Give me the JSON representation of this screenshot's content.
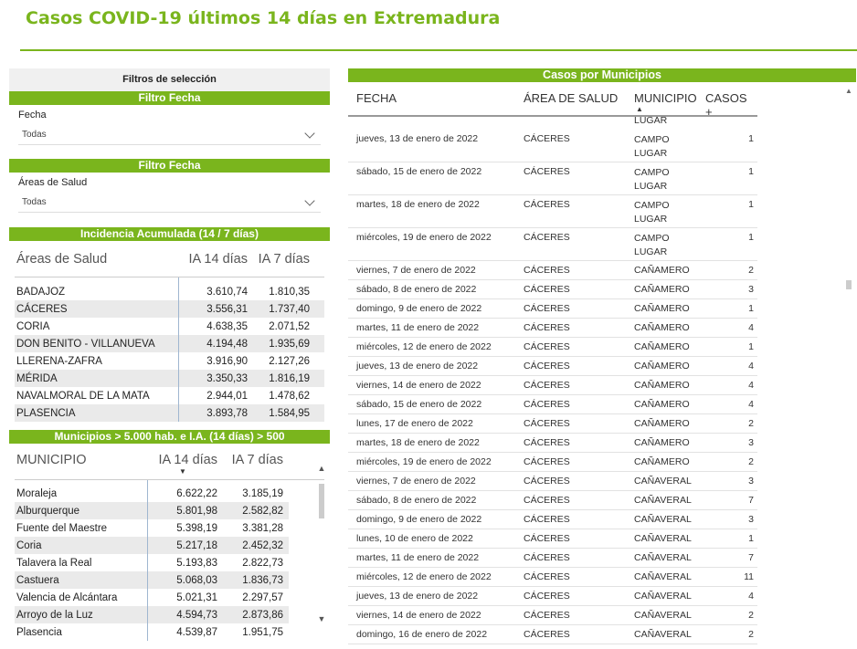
{
  "title": "Casos COVID-19 últimos 14 días en Extremadura",
  "filters": {
    "header": "Filtros de selección",
    "date_filter": {
      "bar": "Filtro Fecha",
      "label": "Fecha",
      "value": "Todas"
    },
    "area_filter": {
      "bar": "Filtro Fecha",
      "label": "Áreas de Salud",
      "value": "Todas"
    }
  },
  "incidence": {
    "bar": "Incidencia Acumulada (14 / 7 días)",
    "headers": [
      "Áreas de Salud",
      "IA 14 días",
      "IA 7 días"
    ],
    "rows": [
      [
        "BADAJOZ",
        "3.610,74",
        "1.810,35"
      ],
      [
        "CÁCERES",
        "3.556,31",
        "1.737,40"
      ],
      [
        "CORIA",
        "4.638,35",
        "2.071,52"
      ],
      [
        "DON BENITO - VILLANUEVA",
        "4.194,48",
        "1.935,69"
      ],
      [
        "LLERENA-ZAFRA",
        "3.916,90",
        "2.127,26"
      ],
      [
        "MÉRIDA",
        "3.350,33",
        "1.816,19"
      ],
      [
        "NAVALMORAL DE LA MATA",
        "2.944,01",
        "1.478,62"
      ],
      [
        "PLASENCIA",
        "3.893,78",
        "1.584,95"
      ]
    ]
  },
  "municipios": {
    "bar": "Municipios > 5.000 hab. e I.A. (14 días) > 500",
    "headers": [
      "MUNICIPIO",
      "IA 14 días",
      "IA 7 días"
    ],
    "sort_icon": "▼",
    "rows": [
      [
        "Moraleja",
        "6.622,22",
        "3.185,19"
      ],
      [
        "Alburquerque",
        "5.801,98",
        "2.582,82"
      ],
      [
        "Fuente del Maestre",
        "5.398,19",
        "3.381,28"
      ],
      [
        "Coria",
        "5.217,18",
        "2.452,32"
      ],
      [
        "Talavera la Real",
        "5.193,83",
        "2.822,73"
      ],
      [
        "Castuera",
        "5.068,03",
        "1.836,73"
      ],
      [
        "Valencia de Alcántara",
        "5.021,31",
        "2.297,57"
      ],
      [
        "Arroyo de la Luz",
        "4.594,73",
        "2.873,86"
      ],
      [
        "Plasencia",
        "4.539,87",
        "1.951,75"
      ]
    ]
  },
  "cases": {
    "bar": "Casos por Municipios",
    "headers": [
      "FECHA",
      "ÁREA DE SALUD",
      "MUNICIPIO",
      "CASOS +"
    ],
    "sort_icon": "▲",
    "top_partial": "LUGAR",
    "rows": [
      [
        "jueves, 13 de enero de 2022",
        "CÁCERES",
        "CAMPO LUGAR",
        "1"
      ],
      [
        "sábado, 15 de enero de 2022",
        "CÁCERES",
        "CAMPO LUGAR",
        "1"
      ],
      [
        "martes, 18 de enero de 2022",
        "CÁCERES",
        "CAMPO LUGAR",
        "1"
      ],
      [
        "miércoles, 19 de enero de 2022",
        "CÁCERES",
        "CAMPO LUGAR",
        "1"
      ],
      [
        "viernes, 7 de enero de 2022",
        "CÁCERES",
        "CAÑAMERO",
        "2"
      ],
      [
        "sábado, 8 de enero de 2022",
        "CÁCERES",
        "CAÑAMERO",
        "3"
      ],
      [
        "domingo, 9 de enero de 2022",
        "CÁCERES",
        "CAÑAMERO",
        "1"
      ],
      [
        "martes, 11 de enero de 2022",
        "CÁCERES",
        "CAÑAMERO",
        "4"
      ],
      [
        "miércoles, 12 de enero de 2022",
        "CÁCERES",
        "CAÑAMERO",
        "1"
      ],
      [
        "jueves, 13 de enero de 2022",
        "CÁCERES",
        "CAÑAMERO",
        "4"
      ],
      [
        "viernes, 14 de enero de 2022",
        "CÁCERES",
        "CAÑAMERO",
        "4"
      ],
      [
        "sábado, 15 de enero de 2022",
        "CÁCERES",
        "CAÑAMERO",
        "4"
      ],
      [
        "lunes, 17 de enero de 2022",
        "CÁCERES",
        "CAÑAMERO",
        "2"
      ],
      [
        "martes, 18 de enero de 2022",
        "CÁCERES",
        "CAÑAMERO",
        "3"
      ],
      [
        "miércoles, 19 de enero de 2022",
        "CÁCERES",
        "CAÑAMERO",
        "2"
      ],
      [
        "viernes, 7 de enero de 2022",
        "CÁCERES",
        "CAÑAVERAL",
        "3"
      ],
      [
        "sábado, 8 de enero de 2022",
        "CÁCERES",
        "CAÑAVERAL",
        "7"
      ],
      [
        "domingo, 9 de enero de 2022",
        "CÁCERES",
        "CAÑAVERAL",
        "3"
      ],
      [
        "lunes, 10 de enero de 2022",
        "CÁCERES",
        "CAÑAVERAL",
        "1"
      ],
      [
        "martes, 11 de enero de 2022",
        "CÁCERES",
        "CAÑAVERAL",
        "7"
      ],
      [
        "miércoles, 12 de enero de 2022",
        "CÁCERES",
        "CAÑAVERAL",
        "11"
      ],
      [
        "jueves, 13 de enero de 2022",
        "CÁCERES",
        "CAÑAVERAL",
        "4"
      ],
      [
        "viernes, 14 de enero de 2022",
        "CÁCERES",
        "CAÑAVERAL",
        "2"
      ],
      [
        "domingo, 16 de enero de 2022",
        "CÁCERES",
        "CAÑAVERAL",
        "2"
      ]
    ]
  },
  "colors": {
    "accent": "#7ab51d",
    "alt_row": "#eaeaea"
  }
}
